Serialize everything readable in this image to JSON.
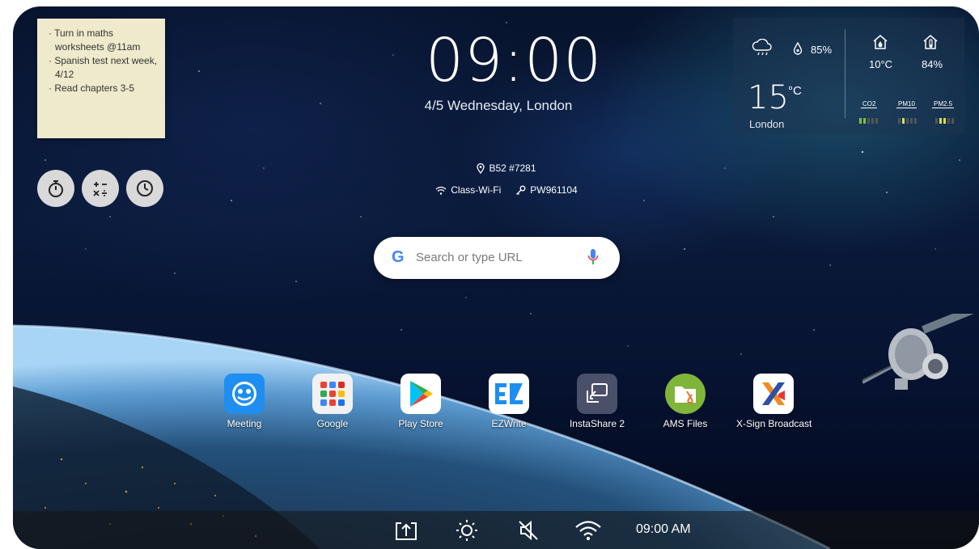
{
  "note": {
    "lines": [
      "Turn in maths worksheets @11am",
      "Spanish test next week, 4/12",
      "Read chapters 3-5"
    ]
  },
  "tools": [
    {
      "icon": "stopwatch-icon"
    },
    {
      "icon": "calculator-icon"
    },
    {
      "icon": "timer-icon"
    }
  ],
  "clock": {
    "time": "09:00",
    "date": "4/5 Wednesday, London"
  },
  "info": {
    "room": "B52 #7281",
    "wifi": "Class-Wi-Fi",
    "password": "PW961104"
  },
  "search": {
    "placeholder": "Search or type URL",
    "logo": "G"
  },
  "weather": {
    "humidity": "85%",
    "temperature": "15",
    "unit": "°C",
    "city": "London",
    "indoor_temp": "10°C",
    "indoor_humidity": "84%",
    "aq": [
      "CO2",
      "PM10",
      "PM2.5"
    ]
  },
  "apps": [
    {
      "label": "Meeting",
      "color": "#1e8ef0"
    },
    {
      "label": "Google",
      "color": "#f1f1f1"
    },
    {
      "label": "Play Store",
      "color": "#ffffff"
    },
    {
      "label": "EZWrite",
      "color": "#ffffff"
    },
    {
      "label": "InstaShare 2",
      "color": "#4a4f6a"
    },
    {
      "label": "AMS Files",
      "color": "#7fb539"
    },
    {
      "label": "X-Sign Broadcast",
      "color": "#ffffff"
    }
  ],
  "taskbar": {
    "time": "09:00 AM"
  }
}
